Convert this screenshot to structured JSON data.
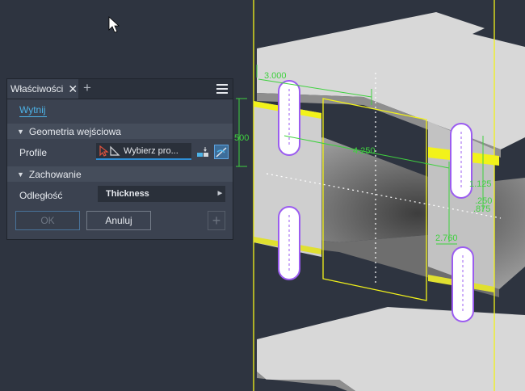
{
  "panel": {
    "tab_title": "Właściwości",
    "close_glyph": "✕",
    "add_glyph": "+",
    "link_label": "Wytnij",
    "section_input_geometry": "Geometria wejściowa",
    "section_behavior": "Zachowanie",
    "profile_label": "Profile",
    "profile_select_text": "Wybierz pro...",
    "distance_label": "Odległość",
    "distance_value": "Thickness",
    "ok_label": "OK",
    "cancel_label": "Anuluj",
    "plus_glyph": "+"
  },
  "dimensions": {
    "d1": "3.000",
    "d2": "500",
    "d3": "4.250",
    "d4": "1.125",
    "d5": ".250",
    "d6": ".875",
    "d7": "2.760"
  },
  "colors": {
    "sketch_yellow": "#f2f21a",
    "dimension_green": "#3fd13f",
    "slot_purple": "#9b5cf0",
    "accent_blue": "#2f8fd6"
  }
}
